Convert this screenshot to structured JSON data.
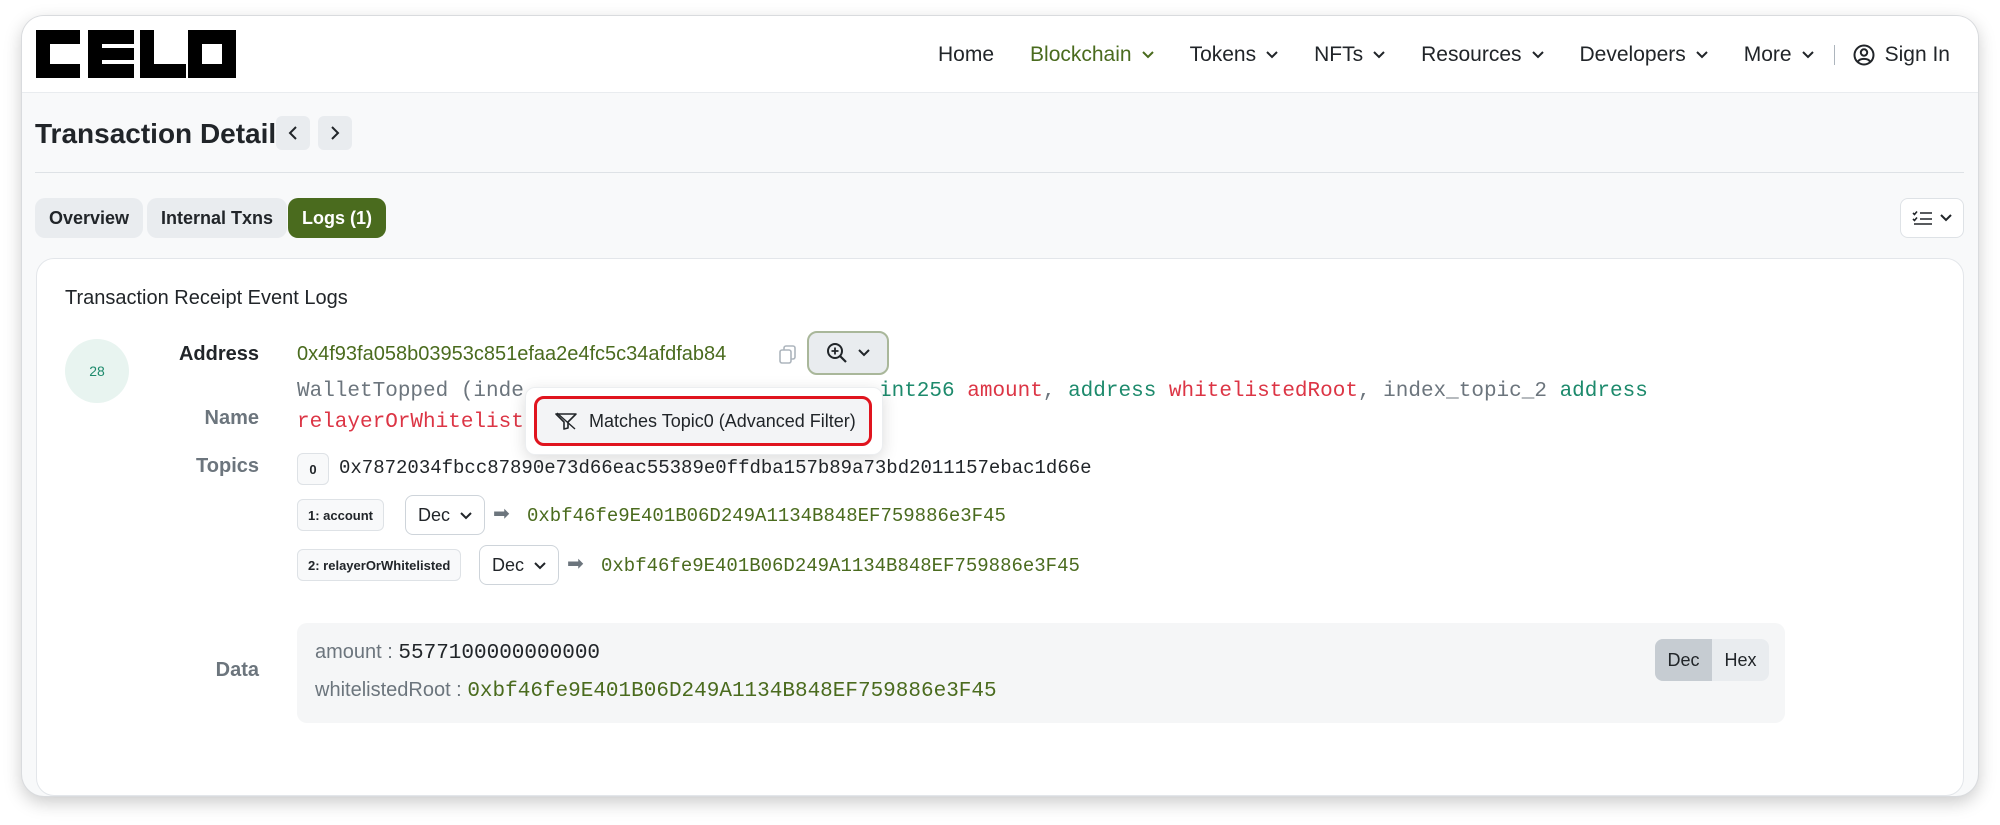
{
  "brand": {
    "logo_text": "CELO",
    "accent": "#4a6b1e"
  },
  "nav": {
    "items": [
      {
        "label": "Home",
        "has_dropdown": false
      },
      {
        "label": "Blockchain",
        "has_dropdown": true,
        "active": true
      },
      {
        "label": "Tokens",
        "has_dropdown": true
      },
      {
        "label": "NFTs",
        "has_dropdown": true
      },
      {
        "label": "Resources",
        "has_dropdown": true
      },
      {
        "label": "Developers",
        "has_dropdown": true
      },
      {
        "label": "More",
        "has_dropdown": true
      }
    ],
    "sign_in": "Sign In"
  },
  "page": {
    "title": "Transaction Details"
  },
  "tabs": [
    {
      "label": "Overview"
    },
    {
      "label": "Internal Txns"
    },
    {
      "label": "Logs (1)",
      "active": true
    }
  ],
  "card": {
    "title": "Transaction Receipt Event Logs",
    "log_index": "28",
    "labels": {
      "address": "Address",
      "name": "Name",
      "topics": "Topics",
      "data": "Data"
    },
    "address": "0x4f93fa058b03953c851efaa2e4fc5c34afdfab84",
    "event": {
      "line1_name": "WalletTopped (inde",
      "line1_type1": "int256",
      "line1_param1": "amount",
      "line1_sep1": ", ",
      "line1_type2": "address",
      "line1_param2": "whitelistedRoot",
      "line1_sep2": ", index_topic_2 ",
      "line1_type3": "address",
      "line2_param": "relayerOrWhitelist"
    },
    "dropdown": {
      "item": "Matches Topic0 (Advanced Filter)"
    },
    "topics": [
      {
        "badge": "0",
        "value": "0x7872034fbcc87890e73d66eac55389e0ffdba157b89a73bd2011157ebac1d66e"
      },
      {
        "badge": "1: account",
        "format": "Dec",
        "arrow": "➡",
        "value": "0xbf46fe9E401B06D249A1134B848EF759886e3F45"
      },
      {
        "badge": "2: relayerOrWhitelisted",
        "format": "Dec",
        "arrow": "➡",
        "value": "0xbf46fe9E401B06D249A1134B848EF759886e3F45"
      }
    ],
    "data": {
      "amount_key": "amount :",
      "amount_value": "5577100000000000",
      "root_key": "whitelistedRoot :",
      "root_value": "0xbf46fe9E401B06D249A1134B848EF759886e3F45",
      "format_options": [
        "Dec",
        "Hex"
      ],
      "format_selected": "Dec"
    }
  }
}
